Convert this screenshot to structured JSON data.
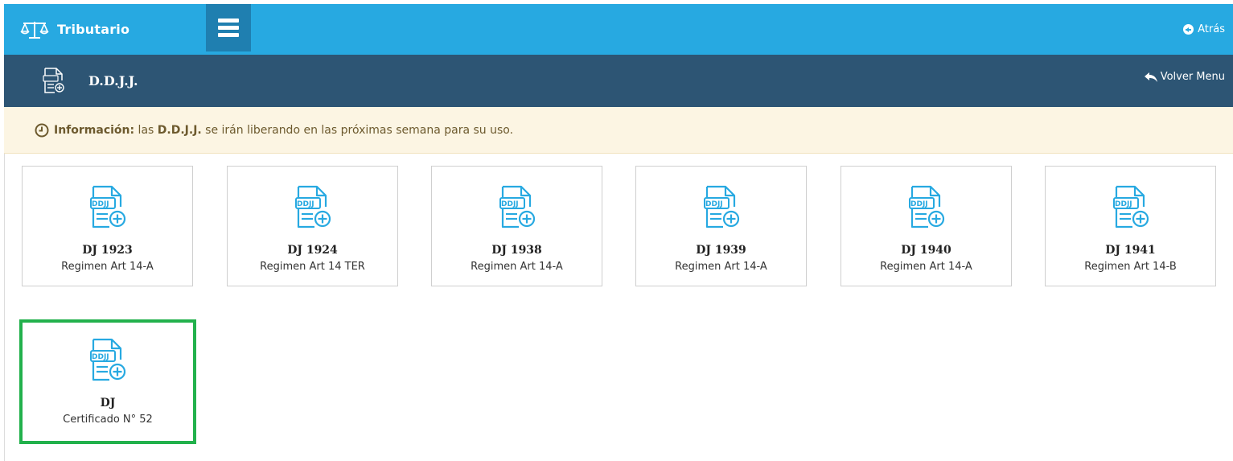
{
  "header": {
    "app_title": "Tributario",
    "back_label": "Atrás",
    "colors": {
      "primary": "#27a9e1",
      "menu_button": "#1f7fb0",
      "subheader": "#2d5574"
    }
  },
  "subheader": {
    "title": "D.D.J.J.",
    "return_label": "Volver Menu",
    "icon": "ddjj-document-icon"
  },
  "alert": {
    "label": "Información:",
    "text_before": " las ",
    "highlight": "D.D.J.J.",
    "text_after": " se irán liberando en las próximas semana para su uso.",
    "icon": "clock-icon",
    "background": "#fcf5e3"
  },
  "cards": [
    {
      "title": "DJ 1923",
      "subtitle": "Regimen Art 14-A",
      "icon": "ddjj-add-document-icon"
    },
    {
      "title": "DJ 1924",
      "subtitle": "Regimen Art 14 TER",
      "icon": "ddjj-add-document-icon"
    },
    {
      "title": "DJ 1938",
      "subtitle": "Regimen Art 14-A",
      "icon": "ddjj-add-document-icon"
    },
    {
      "title": "DJ 1939",
      "subtitle": "Regimen Art 14-A",
      "icon": "ddjj-add-document-icon"
    },
    {
      "title": "DJ 1940",
      "subtitle": "Regimen Art 14-A",
      "icon": "ddjj-add-document-icon"
    },
    {
      "title": "DJ 1941",
      "subtitle": "Regimen Art 14-B",
      "icon": "ddjj-add-document-icon"
    },
    {
      "title": "DJ",
      "subtitle": "Certificado N° 52",
      "icon": "ddjj-add-document-icon",
      "selected": true
    }
  ],
  "icon_label": "DDJJ",
  "selected_border_color": "#22b14c"
}
